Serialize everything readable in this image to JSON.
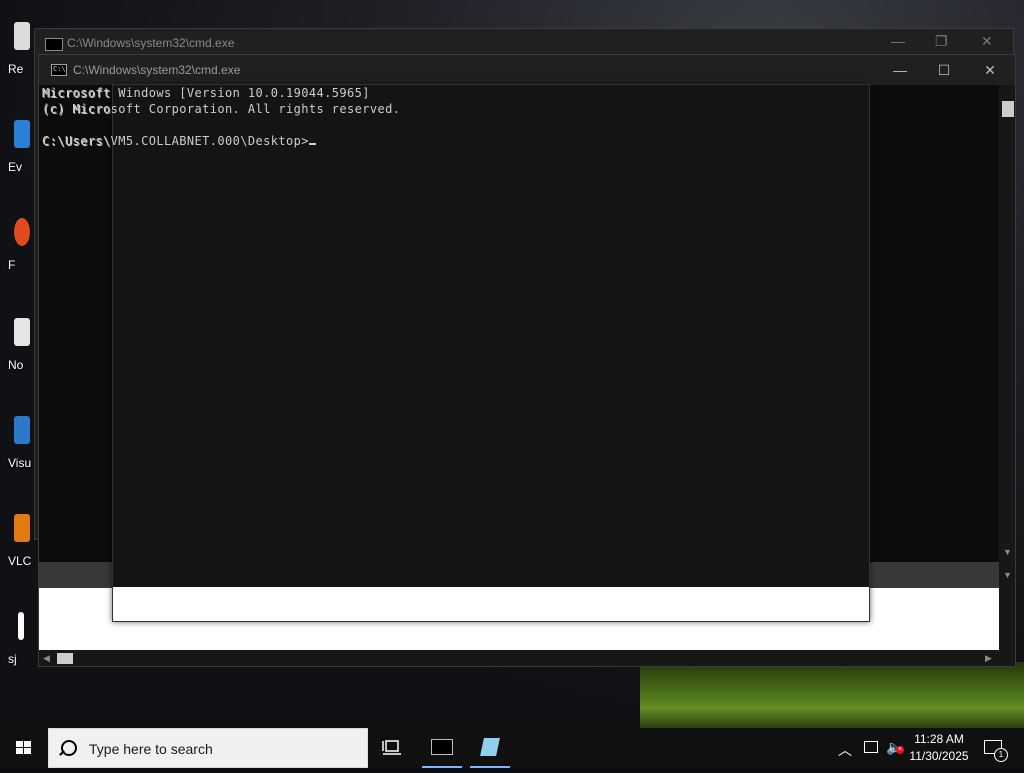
{
  "desktop": {
    "icons": [
      {
        "label": "Re",
        "color": "#dcdcdc"
      },
      {
        "label": "Ev",
        "color": "#2b7fd6"
      },
      {
        "label": "F",
        "color": "#e04a1f"
      },
      {
        "label": "No",
        "color": "#e5e5e5"
      },
      {
        "label": "Visu",
        "color": "#2d78c9"
      },
      {
        "label": "VLC",
        "color": "#e57a10"
      },
      {
        "label": "sj",
        "color": "#ffffff"
      }
    ]
  },
  "background_window": {
    "title": "C:\\Windows\\system32\\cmd.exe",
    "lines": [
      "Microsoft Windows [Version 10.0.19044.5965]",
      "(c) Microsoft Corporation. All rights reserved.",
      "",
      "C:\\Users\\VM5.COLLABNET.000\\Desktop>"
    ]
  },
  "cmd_window": {
    "title": "C:\\Windows\\system32\\cmd.exe",
    "icon": "cmd-icon",
    "controls": {
      "minimize": "—",
      "maximize": "☐",
      "close": "✕"
    },
    "lines": [
      "Microsoft Windows [Version 10.0.19044.5965]",
      "(c) Microsoft Corporation. All rights reserved.",
      "",
      "C:\\Users\\VM5.COLLABNET.000\\Desktop>"
    ]
  },
  "taskbar": {
    "search_placeholder": "Type here to search",
    "clock_time": "11:28 AM",
    "clock_date": "11/30/2025",
    "notification_count": "1",
    "accent": "#7fb3ff"
  }
}
